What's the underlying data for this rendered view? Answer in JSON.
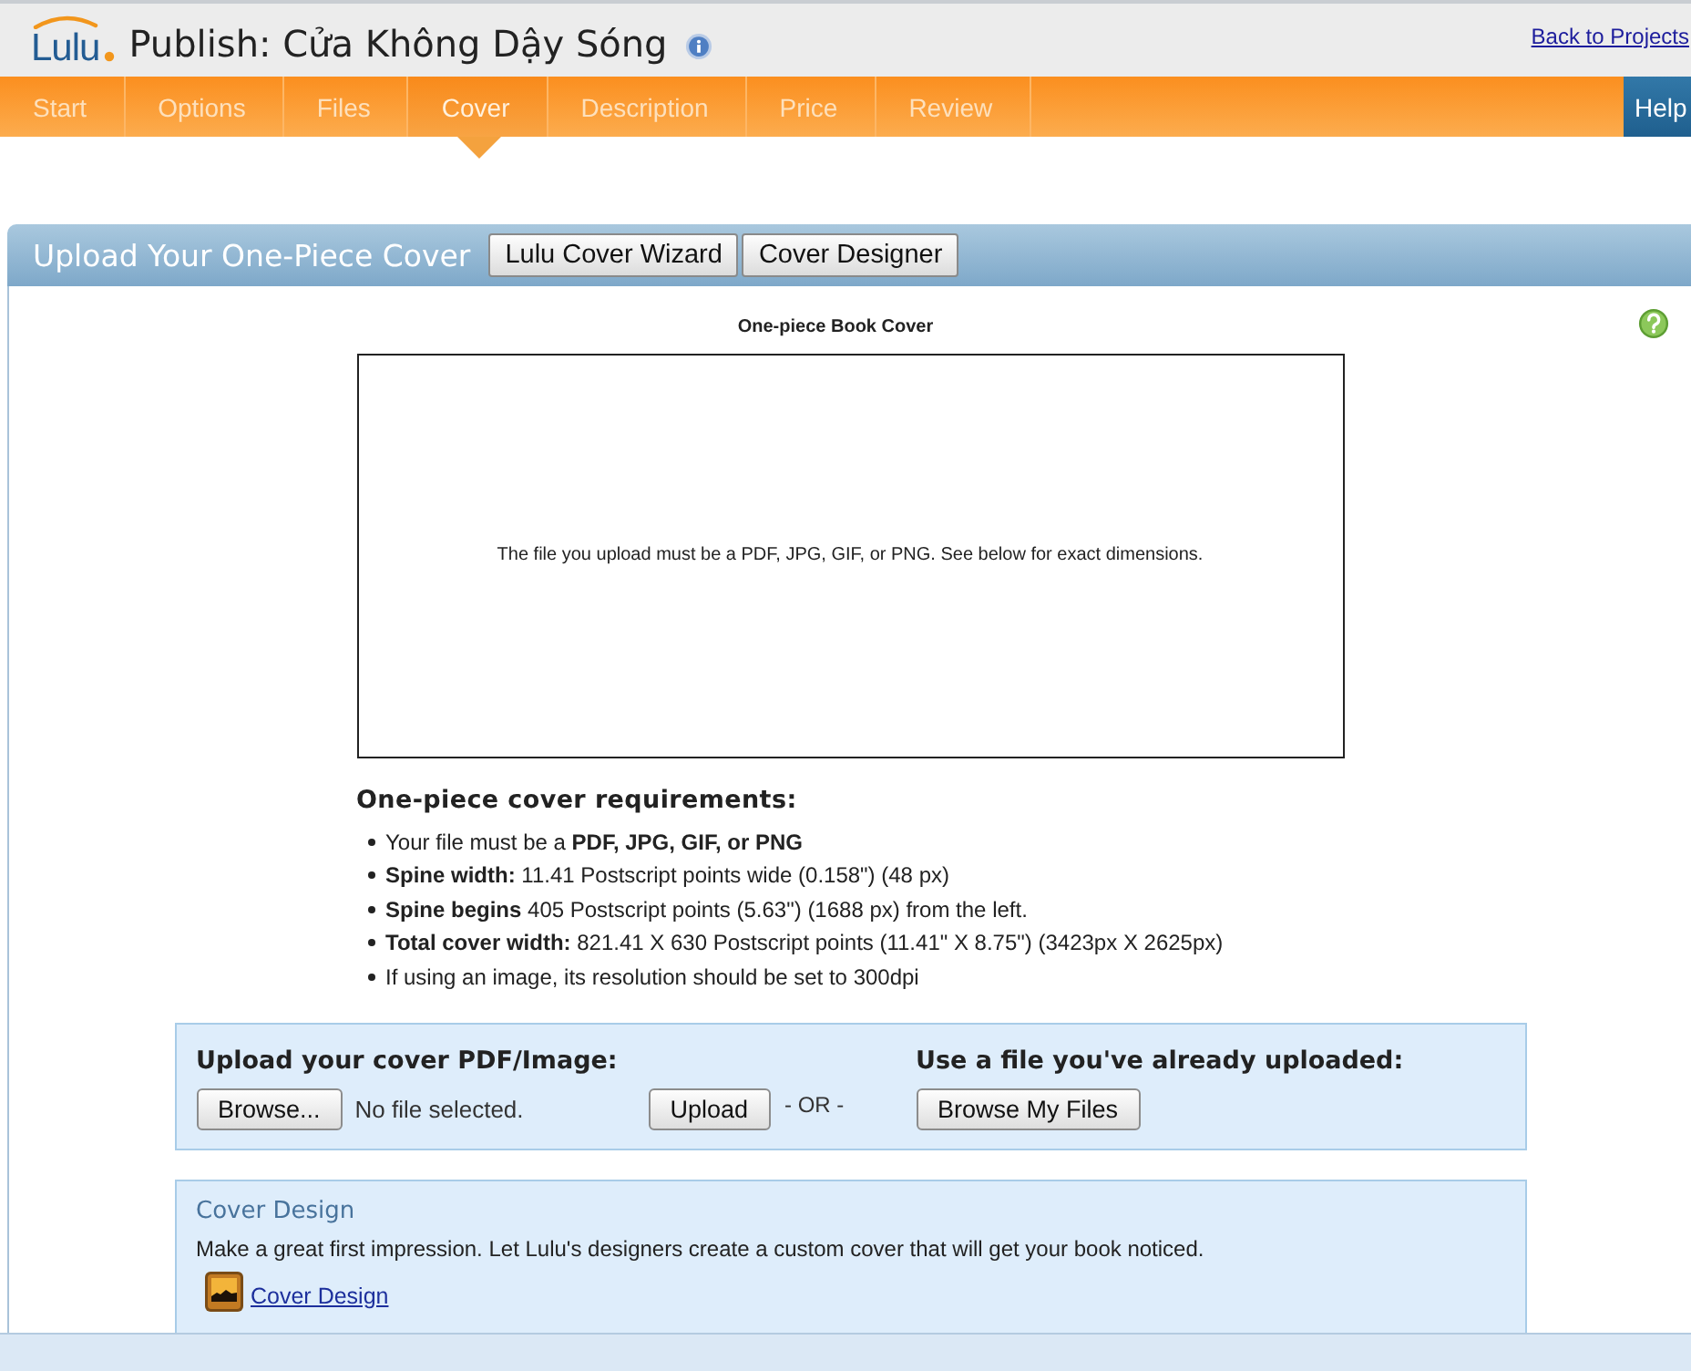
{
  "header": {
    "logo": "Lulu",
    "title": "Publish: Cửa Không Dậy Sóng",
    "back_link": "Back to Projects"
  },
  "nav": {
    "tabs": [
      {
        "label": "Start",
        "selected": false
      },
      {
        "label": "Options",
        "selected": false
      },
      {
        "label": "Files",
        "selected": false
      },
      {
        "label": "Cover",
        "selected": true
      },
      {
        "label": "Description",
        "selected": false
      },
      {
        "label": "Price",
        "selected": false
      },
      {
        "label": "Review",
        "selected": false
      }
    ],
    "help": "Help"
  },
  "panel": {
    "title": "Upload Your One-Piece Cover",
    "buttons": [
      "Lulu Cover Wizard",
      "Cover Designer"
    ],
    "preview": {
      "caption": "One-piece Book Cover",
      "message": "The file you upload must be a PDF, JPG, GIF, or PNG. See below for exact dimensions."
    },
    "requirements": {
      "heading": "One-piece cover requirements:",
      "items": [
        "Your file must be a **PDF, JPG, GIF, or PNG**",
        "**Spine width:** 11.41 Postscript points wide (0.158\") (48 px)",
        "**Spine begins** 405 Postscript points (5.63\") (1688 px) from the left.",
        "**Total cover width:** 821.41 X 630 Postscript points (11.41\" X 8.75\") (3423px X 2625px)",
        "If using an image, its resolution should be set to 300dpi"
      ]
    },
    "upload": {
      "heading": "Upload your cover PDF/Image:",
      "browse_button": "Browse...",
      "file_status": "No file selected.",
      "upload_button": "Upload",
      "separator": "- OR -",
      "existing_heading": "Use a file you've already uploaded:",
      "browse_files_button": "Browse My Files"
    },
    "cover_design": {
      "title": "Cover Design",
      "description": "Make a great first impression. Let Lulu's designers create a custom cover that will get your book noticed.",
      "link": "Cover Design"
    }
  }
}
